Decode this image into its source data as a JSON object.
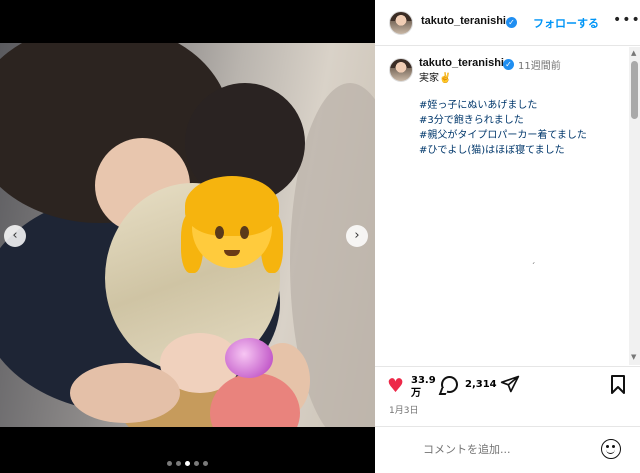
{
  "post": {
    "username": "takuto_teranishi",
    "follow_label": "フォローする",
    "more_label": "•••",
    "verified_glyph": "✓",
    "caption": {
      "time": "11週間前",
      "line0": "実家✌️",
      "tags": [
        "#姪っ子にぬいあげました",
        "#3分で飽きられました",
        "#親父がタイプロパーカー着てました",
        "#ひでよし(猫)はほぼ寝てました"
      ],
      "stray_mark": "ˏ"
    },
    "media": {
      "prev_arrow": "‹",
      "next_arrow": "›",
      "slide_count": 5,
      "active_slide": 3
    },
    "actions": {
      "likes": "33.9万",
      "comments": "2,314",
      "date": "1月3日"
    },
    "add_comment": {
      "placeholder": "コメントを追加..."
    },
    "scrollbar": {
      "up": "▲",
      "down": "▼"
    },
    "colors": {
      "accent": "#0095f6",
      "like": "#ed2848",
      "verified": "#1f8ef1",
      "hashtag": "#00376b"
    },
    "icons": [
      "heart-icon",
      "comment-icon",
      "share-icon",
      "bookmark-icon",
      "emoji-icon",
      "verified-badge-icon"
    ]
  }
}
